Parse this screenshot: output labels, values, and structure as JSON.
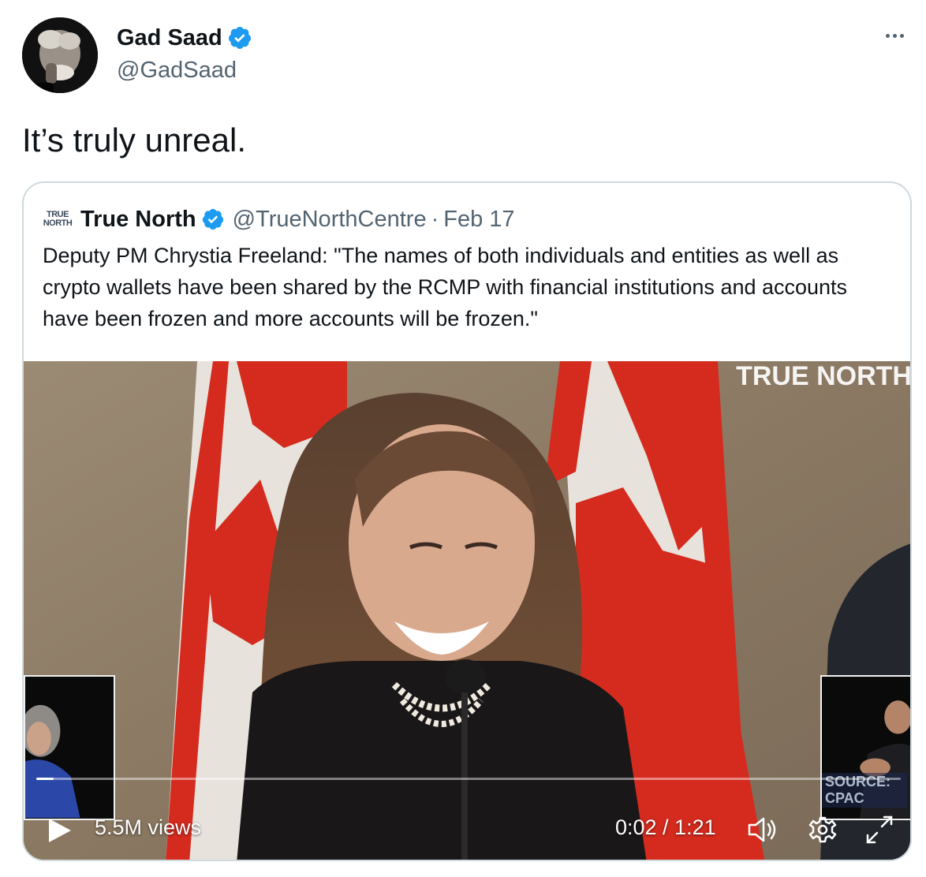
{
  "tweet": {
    "author_name": "Gad Saad",
    "author_handle": "@GadSaad",
    "text": "It’s truly unreal.",
    "more_icon": "more-horizontal-icon",
    "verified_color": "#1d9bf0"
  },
  "quoted_tweet": {
    "logo_line1": "TRUE",
    "logo_line2": "NORTH",
    "author_name": "True North",
    "author_handle": "@TrueNorthCentre",
    "separator": "·",
    "date": "Feb 17",
    "text": "Deputy PM Chrystia Freeland: \"The names of both individuals and entities as well as crypto wallets have been shared by the RCMP with financial institutions and accounts have been frozen and more accounts will be frozen.\""
  },
  "video": {
    "watermark": "TRUE NORTH",
    "source_label": "SOURCE: CPAC",
    "views": "5.5M views",
    "time": "0:02 / 1:21",
    "progress_fraction": 0.02,
    "icons": [
      "play-icon",
      "volume-icon",
      "settings-icon",
      "fullscreen-icon"
    ]
  }
}
